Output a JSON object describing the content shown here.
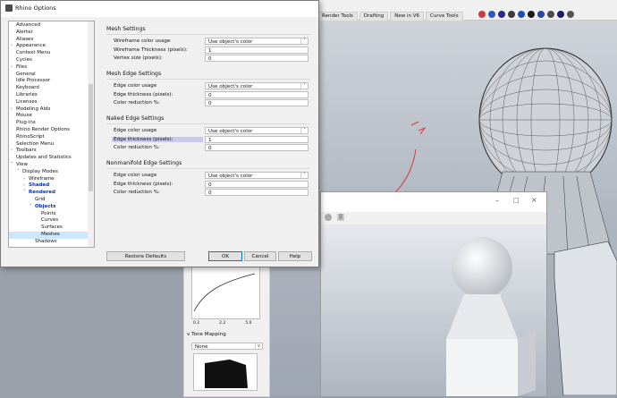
{
  "app": {
    "tabs": [
      "Render Tools",
      "Drafting",
      "New in V6",
      "Curve Tools"
    ],
    "status_colors": [
      "#cf3a3a",
      "#2c5bb8",
      "#2a2a8a",
      "#3b3b3b",
      "#1f4fb0",
      "#1a1a1a",
      "#274a9c",
      "#4b4b4b",
      "#1d1d6a",
      "#555555"
    ]
  },
  "dialog": {
    "title": "Rhino Options",
    "tree": [
      {
        "label": "Advanced",
        "level": 0,
        "exp": ""
      },
      {
        "label": "Alerter",
        "level": 0,
        "exp": ""
      },
      {
        "label": "Aliases",
        "level": 0,
        "exp": ""
      },
      {
        "label": "Appearance",
        "level": 0,
        "exp": ">"
      },
      {
        "label": "Context Menu",
        "level": 0,
        "exp": ""
      },
      {
        "label": "Cycles",
        "level": 0,
        "exp": ""
      },
      {
        "label": "Files",
        "level": 0,
        "exp": ">"
      },
      {
        "label": "General",
        "level": 0,
        "exp": ""
      },
      {
        "label": "Idle Processor",
        "level": 0,
        "exp": ""
      },
      {
        "label": "Keyboard",
        "level": 0,
        "exp": ""
      },
      {
        "label": "Libraries",
        "level": 0,
        "exp": ""
      },
      {
        "label": "Licenses",
        "level": 0,
        "exp": ""
      },
      {
        "label": "Modeling Aids",
        "level": 0,
        "exp": ">"
      },
      {
        "label": "Mouse",
        "level": 0,
        "exp": ""
      },
      {
        "label": "Plug-ins",
        "level": 0,
        "exp": ""
      },
      {
        "label": "Rhino Render Options",
        "level": 0,
        "exp": ""
      },
      {
        "label": "RhinoScript",
        "level": 0,
        "exp": ""
      },
      {
        "label": "Selection Menu",
        "level": 0,
        "exp": ""
      },
      {
        "label": "Toolbars",
        "level": 0,
        "exp": ">"
      },
      {
        "label": "Updates and Statistics",
        "level": 0,
        "exp": ""
      },
      {
        "label": "View",
        "level": 0,
        "exp": "v"
      },
      {
        "label": "Display Modes",
        "level": 1,
        "exp": "v"
      },
      {
        "label": "Wireframe",
        "level": 2,
        "exp": ">"
      },
      {
        "label": "Shaded",
        "level": 2,
        "exp": ">",
        "bold": true
      },
      {
        "label": "Rendered",
        "level": 2,
        "exp": "v",
        "bold": true
      },
      {
        "label": "Grid",
        "level": 3,
        "exp": ""
      },
      {
        "label": "Objects",
        "level": 3,
        "exp": "v",
        "bold": true
      },
      {
        "label": "Points",
        "level": 4,
        "exp": ""
      },
      {
        "label": "Curves",
        "level": 4,
        "exp": ""
      },
      {
        "label": "Surfaces",
        "level": 4,
        "exp": ""
      },
      {
        "label": "Meshes",
        "level": 4,
        "exp": "",
        "selected": true
      },
      {
        "label": "Shadows",
        "level": 3,
        "exp": ""
      }
    ],
    "sections": [
      {
        "title": "Mesh Settings",
        "rows": [
          {
            "label": "Wireframe color usage",
            "value": "Use object's color",
            "kind": "select"
          },
          {
            "label": "Wireframe Thickness (pixels):",
            "value": "1",
            "kind": "input"
          },
          {
            "label": "Vertex size (pixels):",
            "value": "0",
            "kind": "input"
          }
        ]
      },
      {
        "title": "Mesh Edge Settings",
        "rows": [
          {
            "label": "Edge color usage",
            "value": "Use object's color",
            "kind": "select"
          },
          {
            "label": "Edge thickness (pixels):",
            "value": "0",
            "kind": "input"
          },
          {
            "label": "Color reduction %:",
            "value": "0",
            "kind": "input"
          }
        ]
      },
      {
        "title": "Naked Edge Settings",
        "rows": [
          {
            "label": "Edge color usage",
            "value": "Use object's color",
            "kind": "select"
          },
          {
            "label": "Edge thickness (pixels):",
            "value": "1",
            "kind": "input",
            "highlight": true
          },
          {
            "label": "Color reduction %:",
            "value": "0",
            "kind": "input"
          }
        ]
      },
      {
        "title": "Nonmanifold Edge Settings",
        "rows": [
          {
            "label": "Edge color usage",
            "value": "Use object's color",
            "kind": "select"
          },
          {
            "label": "Edge thickness (pixels):",
            "value": "0",
            "kind": "input"
          },
          {
            "label": "Color reduction %:",
            "value": "0",
            "kind": "input"
          }
        ]
      }
    ],
    "buttons": {
      "restore": "Restore Defaults",
      "ok": "OK",
      "cancel": "Cancel",
      "help": "Help"
    },
    "accent": "#0078d7",
    "highlight": "#c8c8f0"
  },
  "render_panel": {
    "curve_ticks": [
      "0.2",
      "2.2",
      "5.0"
    ],
    "section_title": "Tone Mapping",
    "tone_mapping_value": "None"
  }
}
